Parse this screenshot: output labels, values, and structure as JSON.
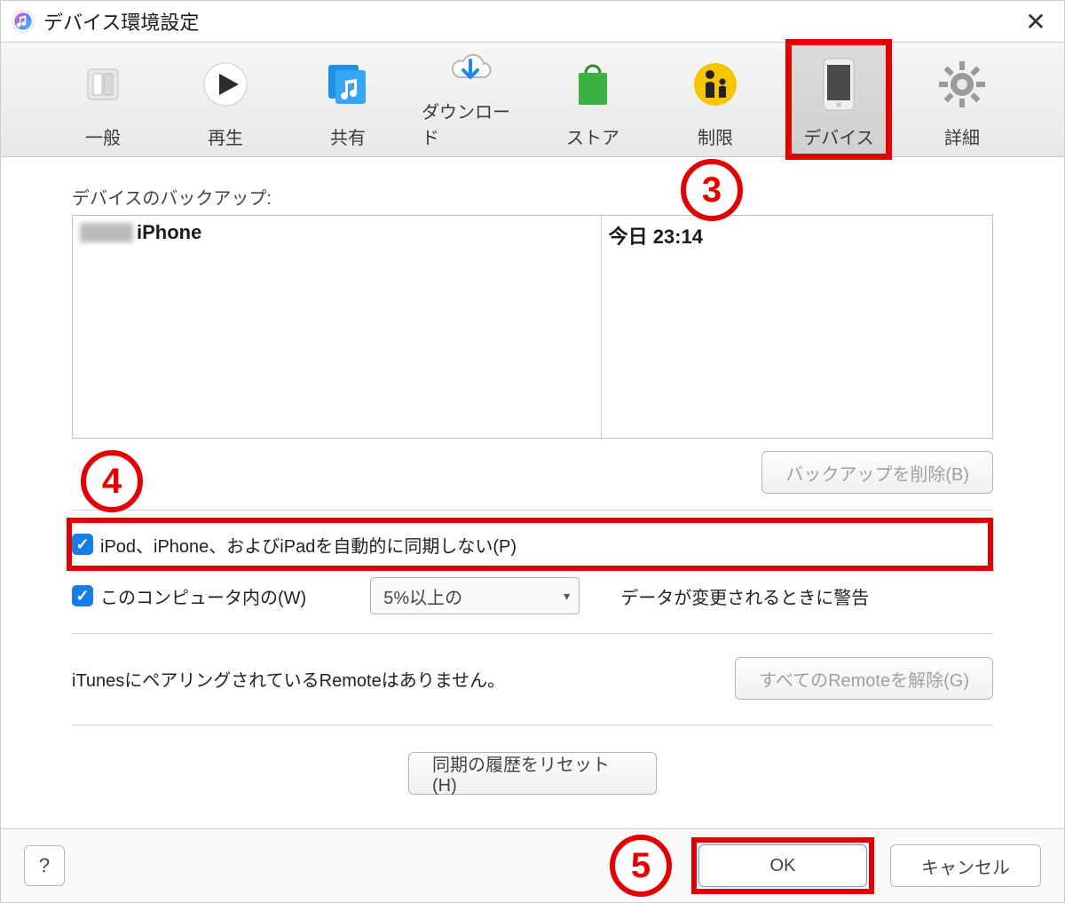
{
  "title": "デバイス環境設定",
  "tabs": {
    "general": "一般",
    "playback": "再生",
    "sharing": "共有",
    "downloads": "ダウンロード",
    "store": "ストア",
    "restrictions": "制限",
    "devices": "デバイス",
    "advanced": "詳細"
  },
  "labels": {
    "backup_section": "デバイスのバックアップ:",
    "device_name": "iPhone",
    "backup_time": "今日 23:14",
    "delete_backup": "バックアップを削除(B)",
    "prevent_sync": "iPod、iPhone、およびiPadを自動的に同期しない(P)",
    "warn_cb": "このコンピュータ内の(W)",
    "threshold": "5%以上の",
    "warn_suffix": "データが変更されるときに警告",
    "remote_none": "iTunesにペアリングされているRemoteはありません。",
    "forget_remotes": "すべてのRemoteを解除(G)",
    "reset_history": "同期の履歴をリセット(H)"
  },
  "footer": {
    "help": "?",
    "ok": "OK",
    "cancel": "キャンセル"
  },
  "annotations": {
    "n3": "3",
    "n4": "4",
    "n5": "5"
  }
}
